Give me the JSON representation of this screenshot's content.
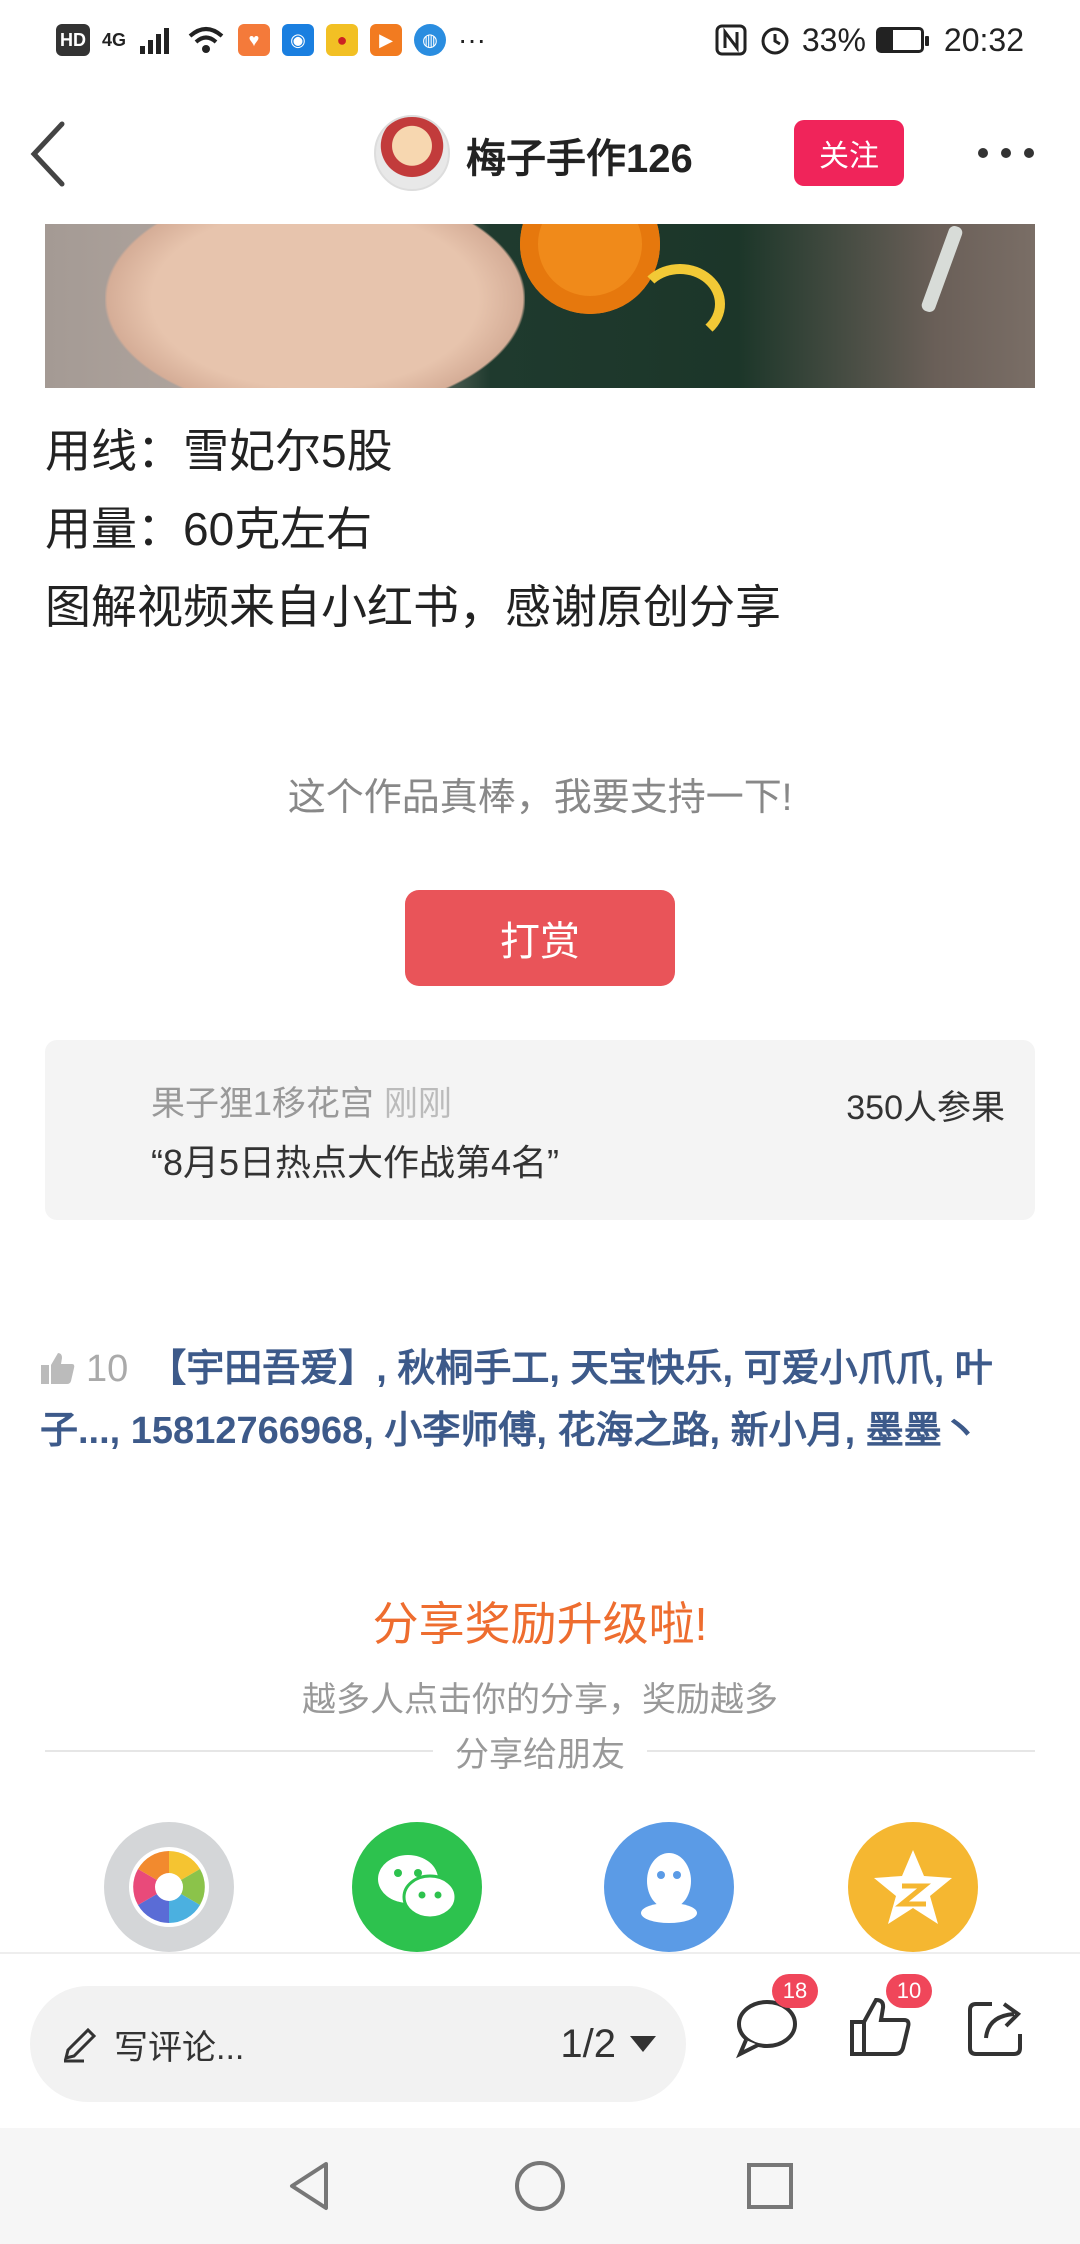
{
  "status_bar": {
    "hd": "HD",
    "network": "4G",
    "battery": "33%",
    "battery_level": 0.33,
    "time": "20:32",
    "overflow": "···"
  },
  "header": {
    "author": "梅子手作126",
    "follow_label": "关注"
  },
  "article": {
    "lines": [
      "用线：雪妃尔5股",
      "用量：60克左右",
      "图解视频来自小红书，感谢原创分享"
    ],
    "support_text": "这个作品真棒，我要支持一下!",
    "reward_label": "打赏"
  },
  "fruit_card": {
    "user": "果子狸1移花宫",
    "time": "刚刚",
    "quote": "“8月5日热点大作战第4名”",
    "count": "350人参果"
  },
  "likes": {
    "count": "10",
    "names": "【宇田吾爱】, 秋桐手工, 天宝快乐, 可爱小爪爪, 叶子..., 15812766968, 小李师傅, 花海之路, 新小月, 墨墨丶"
  },
  "share": {
    "title": "分享奖励升级啦!",
    "subtitle": "越多人点击你的分享，奖励越多",
    "divider_label": "分享给朋友",
    "targets": [
      "moments",
      "wechat",
      "qq",
      "qzone"
    ],
    "colors": {
      "moments_bg": "#d4d6d8",
      "wechat": "#2dc24e",
      "qq": "#5b9be6",
      "qzone": "#f5b731"
    }
  },
  "bottom_bar": {
    "comment_placeholder": "写评论...",
    "page_indicator": "1/2",
    "comment_badge": "18",
    "like_badge": "10"
  },
  "colors": {
    "accent_red": "#f0245a",
    "reward_red": "#e95459",
    "share_orange": "#ee6d2f",
    "link_blue": "#3d5a8a"
  }
}
